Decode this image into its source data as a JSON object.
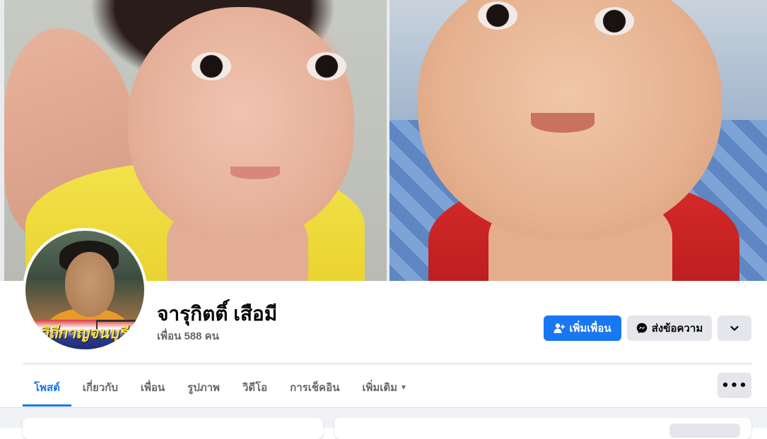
{
  "profile": {
    "name": "จารุกิตติ์ เสือมี",
    "friend_count": "เพื่อน 588 คน",
    "avatar_banner_text": "วิถีกาญจนบุรี"
  },
  "actions": {
    "add_friend_label": "เพิ่มเพื่อน",
    "add_friend_icon": "person-add-icon",
    "message_label": "ส่งข้อความ",
    "message_icon": "messenger-icon",
    "more_icon": "chevron-down-icon"
  },
  "tabs": [
    {
      "label": "โพสต์",
      "active": true
    },
    {
      "label": "เกี่ยวกับ",
      "active": false
    },
    {
      "label": "เพื่อน",
      "active": false
    },
    {
      "label": "รูปภาพ",
      "active": false
    },
    {
      "label": "วิดีโอ",
      "active": false
    },
    {
      "label": "การเช็คอิน",
      "active": false
    },
    {
      "label": "เพิ่มเติม",
      "active": false,
      "has_dropdown": true
    }
  ],
  "tabs_more_icon": "ellipsis-icon",
  "colors": {
    "accent": "#1877f2",
    "secondary_button": "#e4e6eb",
    "muted_text": "#65676b",
    "page_background": "#f0f2f5"
  }
}
